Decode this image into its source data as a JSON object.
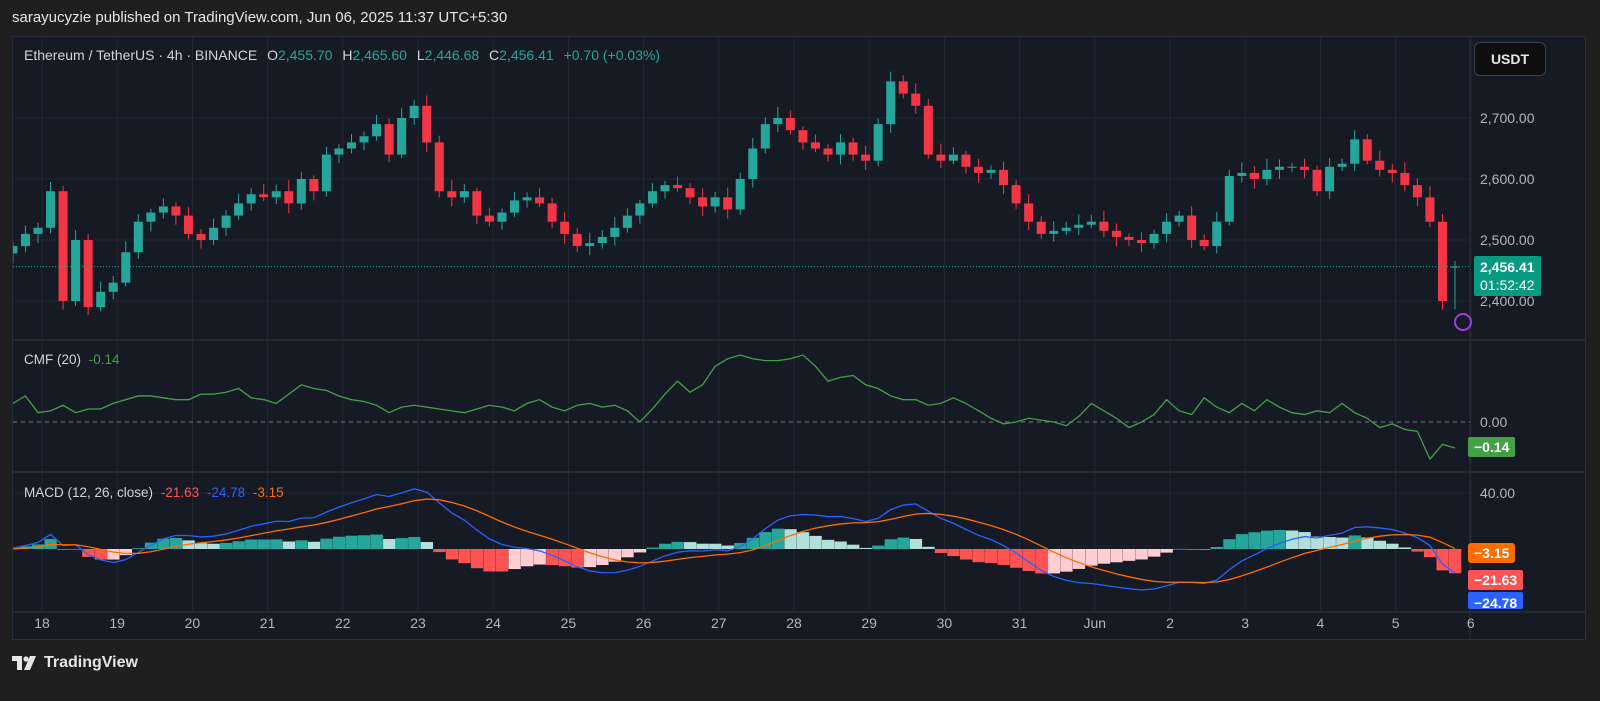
{
  "publish_line": "sarayucyzie published on TradingView.com, Jun 06, 2025 11:37 UTC+5:30",
  "legend": {
    "symbol": "Ethereum / TetherUS · 4h · BINANCE",
    "o_label": "O",
    "o": "2,455.70",
    "h_label": "H",
    "h": "2,465.60",
    "l_label": "L",
    "l": "2,446.68",
    "c_label": "C",
    "c": "2,456.41",
    "change": "+0.70 (+0.03%)"
  },
  "currency_button": "USDT",
  "price_axis": [
    "2,700.00",
    "2,600.00",
    "2,500.00",
    "2,400.00"
  ],
  "price_tag": {
    "price": "2,456.41",
    "countdown": "01:52:42"
  },
  "cmf": {
    "label": "CMF (20)",
    "value": "-0.14",
    "axis_zero": "0.00",
    "tag": "−0.14"
  },
  "macd": {
    "label": "MACD (12, 26, close)",
    "hist": "-21.63",
    "macd": "-24.78",
    "signal": "-3.15",
    "axis_top": "40.00",
    "tag_signal": "−3.15",
    "tag_hist": "−21.63",
    "tag_macd": "−24.78"
  },
  "footer_logo": "TradingView",
  "colors": {
    "up": "#26a69a",
    "down": "#f23645",
    "cmf": "#43a047",
    "macd": "#2962ff",
    "signal": "#ff6d00"
  },
  "chart_data": {
    "type": "candlestick",
    "title": "Ethereum / TetherUS · 4h · BINANCE",
    "ylim": [
      2350,
      2800
    ],
    "x_tick_labels": [
      "18",
      "19",
      "20",
      "21",
      "22",
      "23",
      "24",
      "25",
      "26",
      "27",
      "28",
      "29",
      "30",
      "31",
      "Jun",
      "2",
      "3",
      "4",
      "5",
      "6"
    ],
    "closes": [
      2480,
      2478,
      2490,
      2510,
      2520,
      2580,
      2400,
      2500,
      2390,
      2415,
      2430,
      2480,
      2530,
      2545,
      2555,
      2540,
      2510,
      2500,
      2520,
      2540,
      2560,
      2575,
      2570,
      2580,
      2560,
      2600,
      2580,
      2640,
      2650,
      2660,
      2670,
      2690,
      2640,
      2700,
      2720,
      2660,
      2580,
      2570,
      2580,
      2540,
      2530,
      2545,
      2565,
      2570,
      2560,
      2530,
      2510,
      2490,
      2495,
      2505,
      2520,
      2540,
      2560,
      2580,
      2590,
      2585,
      2570,
      2555,
      2570,
      2550,
      2600,
      2650,
      2690,
      2700,
      2680,
      2660,
      2650,
      2640,
      2660,
      2640,
      2630,
      2690,
      2760,
      2740,
      2720,
      2640,
      2630,
      2640,
      2620,
      2610,
      2615,
      2590,
      2560,
      2530,
      2510,
      2515,
      2520,
      2525,
      2530,
      2515,
      2505,
      2500,
      2495,
      2510,
      2530,
      2540,
      2500,
      2490,
      2530,
      2605,
      2610,
      2600,
      2615,
      2620,
      2620,
      2615,
      2580,
      2620,
      2625,
      2665,
      2630,
      2615,
      2610,
      2590,
      2570,
      2530,
      2400,
      2456.41
    ],
    "cmf_values": [
      0.12,
      0.1,
      0.11,
      0.09,
      0.09,
      0.1,
      0.14,
      0.05,
      0.06,
      0.09,
      0.05,
      0.07,
      0.07,
      0.1,
      0.12,
      0.14,
      0.14,
      0.13,
      0.12,
      0.12,
      0.15,
      0.15,
      0.16,
      0.18,
      0.13,
      0.12,
      0.1,
      0.15,
      0.2,
      0.18,
      0.17,
      0.14,
      0.12,
      0.11,
      0.09,
      0.05,
      0.08,
      0.09,
      0.08,
      0.07,
      0.06,
      0.05,
      0.07,
      0.09,
      0.08,
      0.06,
      0.1,
      0.12,
      0.08,
      0.06,
      0.09,
      0.1,
      0.08,
      0.09,
      0.06,
      0.0,
      0.07,
      0.15,
      0.22,
      0.16,
      0.2,
      0.3,
      0.34,
      0.36,
      0.34,
      0.33,
      0.33,
      0.34,
      0.36,
      0.3,
      0.22,
      0.24,
      0.25,
      0.2,
      0.18,
      0.14,
      0.12,
      0.12,
      0.09,
      0.1,
      0.13,
      0.1,
      0.06,
      0.02,
      -0.01,
      0.0,
      0.02,
      0.01,
      0.0,
      -0.02,
      0.03,
      0.1,
      0.06,
      0.02,
      -0.03,
      0.0,
      0.04,
      0.12,
      0.06,
      0.04,
      0.13,
      0.08,
      0.05,
      0.1,
      0.06,
      0.12,
      0.08,
      0.05,
      0.04,
      0.06,
      0.05,
      0.1,
      0.05,
      0.02,
      -0.03,
      -0.01,
      -0.04,
      -0.05,
      -0.2,
      -0.12,
      -0.14
    ],
    "last": {
      "open": 2455.7,
      "high": 2465.6,
      "low": 2446.68,
      "close": 2456.41
    }
  }
}
